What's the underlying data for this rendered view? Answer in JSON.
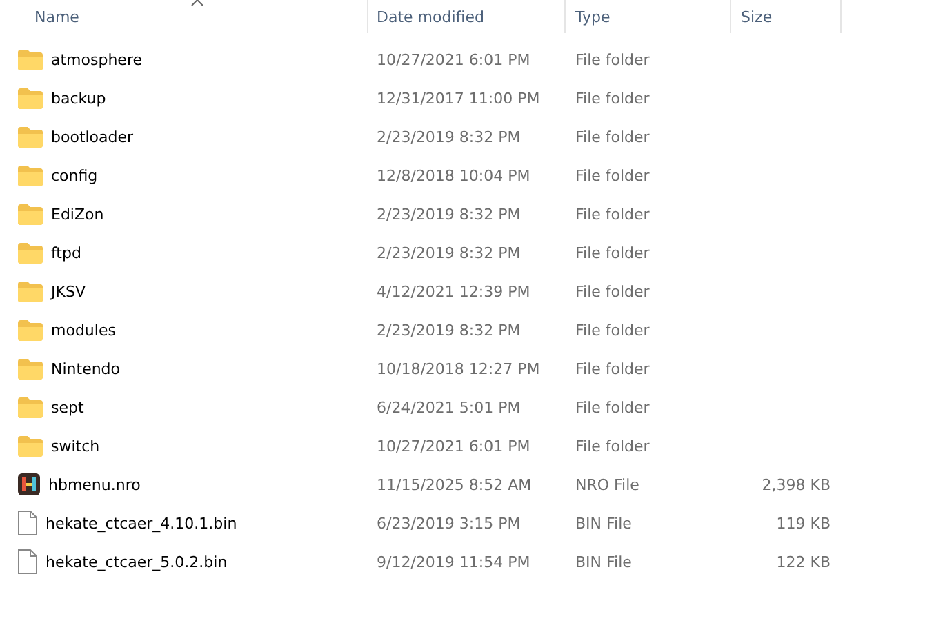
{
  "table": {
    "columns": [
      "Name",
      "Date modified",
      "Type",
      "Size"
    ],
    "rows": [
      {
        "kind": "folder",
        "name": "atmosphere",
        "date": "10/27/2021 6:01 PM",
        "type": "File folder"
      },
      {
        "kind": "folder",
        "name": "backup",
        "date": "12/31/2017 11:00 PM",
        "type": "File folder"
      },
      {
        "kind": "folder",
        "name": "bootloader",
        "date": "2/23/2019 8:32 PM",
        "type": "File folder"
      },
      {
        "kind": "folder",
        "name": "config",
        "date": "12/8/2018 10:04 PM",
        "type": "File folder"
      },
      {
        "kind": "folder",
        "name": "EdiZon",
        "date": "2/23/2019 8:32 PM",
        "type": "File folder"
      },
      {
        "kind": "folder",
        "name": "ftpd",
        "date": "2/23/2019 8:32 PM",
        "type": "File folder"
      },
      {
        "kind": "folder",
        "name": "JKSV",
        "date": "4/12/2021 12:39 PM",
        "type": "File folder"
      },
      {
        "kind": "folder",
        "name": "modules",
        "date": "2/23/2019 8:32 PM",
        "type": "File folder"
      },
      {
        "kind": "folder",
        "name": "Nintendo",
        "date": "10/18/2018 12:27 PM",
        "type": "File folder"
      },
      {
        "kind": "folder",
        "name": "sept",
        "date": "6/24/2021 5:01 PM",
        "type": "File folder"
      },
      {
        "kind": "folder",
        "name": "switch",
        "date": "10/27/2021 6:01 PM",
        "type": "File folder"
      },
      {
        "kind": "app",
        "name": "hbmenu.nro",
        "date": "11/15/2025 8:52 AM",
        "type": "NRO File",
        "size": "2,398 KB"
      },
      {
        "kind": "file",
        "name": "hekate_ctcaer_4.10.1.bin",
        "date": "6/23/2019 3:15 PM",
        "type": "BIN File",
        "size": "119 KB"
      },
      {
        "kind": "file",
        "name": "hekate_ctcaer_5.0.2.bin",
        "date": "9/12/2019 11:54 PM",
        "type": "BIN File",
        "size": "122 KB"
      }
    ]
  }
}
